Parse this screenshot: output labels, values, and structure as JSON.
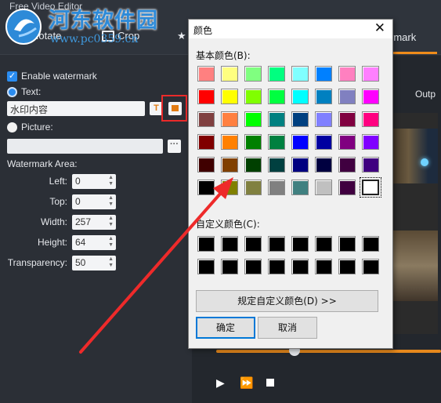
{
  "app": {
    "title": "Free Video Editor"
  },
  "toolbar": {
    "rotate_label": "Rotate",
    "crop_label": "Crop",
    "effect_label": "",
    "watermark_label": "rmark",
    "accent_color": "#f08c1a"
  },
  "overlay_logo": {
    "text": "河东软件园",
    "url": "www.pc0359.cn"
  },
  "left_panel": {
    "enable_watermark": {
      "label": "Enable watermark",
      "checked": true
    },
    "text_option": {
      "label": "Text:",
      "selected": true
    },
    "text_value": "水印内容",
    "font_button_icon": "T",
    "picture_option": {
      "label": "Picture:",
      "selected": false
    },
    "browse_label": "···",
    "area_heading": "Watermark Area:",
    "fields": [
      {
        "label": "Left:",
        "value": "0"
      },
      {
        "label": "Top:",
        "value": "0"
      },
      {
        "label": "Width:",
        "value": "257"
      },
      {
        "label": "Height:",
        "value": "64"
      },
      {
        "label": "Transparency:",
        "value": "50"
      }
    ]
  },
  "right_area": {
    "output_tab": "Outp",
    "controls": {
      "play": "▶",
      "fast_forward": "⏩"
    }
  },
  "color_dialog": {
    "title": "颜色",
    "close": "✕",
    "basic_label": "基本颜色(B):",
    "custom_label": "自定义颜色(C):",
    "define_button": "规定自定义颜色(D) >>",
    "ok_button": "确定",
    "cancel_button": "取消",
    "basic_colors": [
      "#ff8080",
      "#ffff80",
      "#80ff80",
      "#00ff80",
      "#80ffff",
      "#0080ff",
      "#ff80c0",
      "#ff80ff",
      "#ff0000",
      "#ffff00",
      "#80ff00",
      "#00ff40",
      "#00ffff",
      "#0080c0",
      "#8080c0",
      "#ff00ff",
      "#804040",
      "#ff8040",
      "#00ff00",
      "#008080",
      "#004080",
      "#8080ff",
      "#800040",
      "#ff0080",
      "#800000",
      "#ff8000",
      "#008000",
      "#008040",
      "#0000ff",
      "#0000a0",
      "#800080",
      "#8000ff",
      "#400000",
      "#804000",
      "#004000",
      "#004040",
      "#000080",
      "#000040",
      "#400040",
      "#400080",
      "#000000",
      "#808000",
      "#808040",
      "#808080",
      "#408080",
      "#c0c0c0",
      "#400040",
      "#ffffff"
    ],
    "selected_index": 47,
    "custom_colors": [
      "#000000",
      "#000000",
      "#000000",
      "#000000",
      "#000000",
      "#000000",
      "#000000",
      "#000000",
      "#000000",
      "#000000",
      "#000000",
      "#000000",
      "#000000",
      "#000000",
      "#000000",
      "#000000"
    ]
  }
}
